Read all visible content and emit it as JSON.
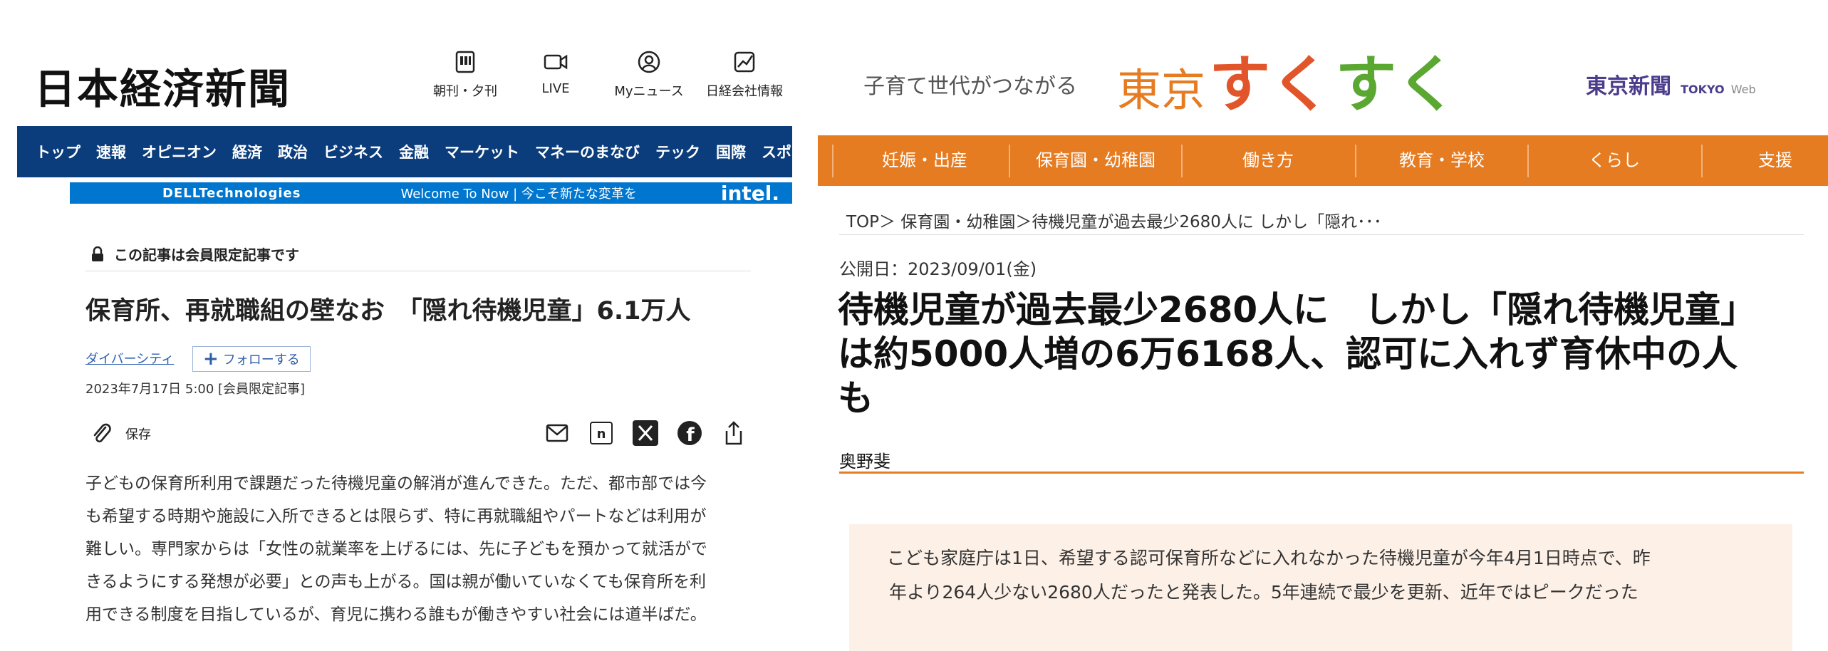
{
  "nikkei": {
    "logo": "日本経済新聞",
    "header_links": [
      "朝刊・夕刊",
      "LIVE",
      "Myニュース",
      "日経会社情報"
    ],
    "nav": [
      "トップ",
      "速報",
      "オピニオン",
      "経済",
      "政治",
      "ビジネス",
      "金融",
      "マーケット",
      "マネーのまなび",
      "テック",
      "国際",
      "スポーツ"
    ],
    "ad": {
      "brand": "DELLTechnologies",
      "text": "Welcome To Now | 今こそ新たな変革を",
      "partner": "intel."
    },
    "member_notice": "この記事は会員限定記事です",
    "title": "保育所、再就職組の壁なお　「隠れ待機児童」6.1万人",
    "topic_tag": "ダイバーシティ",
    "follow_label": "フォローする",
    "date": "2023年7月17日 5:00 [会員限定記事]",
    "save_label": "保存",
    "share_icons": [
      "mail-icon",
      "note-icon",
      "x-icon",
      "facebook-icon",
      "share-icon"
    ],
    "body_lines": [
      "子どもの保育所利用で課題だった待機児童の解消が進んできた。ただ、都市部では今",
      "も希望する時期や施設に入所できるとは限らず、特に再就職組やパートなどは利用が",
      "難しい。専門家からは「女性の就業率を上げるには、先に子どもを預かって就活がで",
      "きるようにする発想が必要」との声も上がる。国は親が働いていなくても保育所を利",
      "用できる制度を目指しているが、育児に携わる誰もが働きやすい社会には道半ばだ。"
    ]
  },
  "tokyo": {
    "tagline": "子育て世代がつながる",
    "logo_main": "東京",
    "logo_sub_1": "すく",
    "logo_sub_2": "すく",
    "newspaper": "東京新聞",
    "newspaper_en": "TOKYO",
    "newspaper_web": "Web",
    "nav": [
      "妊娠・出産",
      "保育園・幼稚園",
      "働き方",
      "教育・学校",
      "くらし",
      "支援"
    ],
    "breadcrumb": "TOP＞ 保育園・幼稚園＞待機児童が過去最少2680人に しかし「隠れ･･･",
    "published": "公開日：2023/09/01(金)",
    "title_lines": [
      "待機児童が過去最少2680人に　しかし「隠れ待機児童」",
      "は約5000人増の6万6168人、認可に入れず育休中の人",
      "も"
    ],
    "author": "奥野斐",
    "lead_lines": [
      "　こども家庭庁は1日、希望する認可保育所などに入れなかった待機児童が今年4月1日時点で、昨",
      "年より264人少ない2680人だったと発表した。5年連続で最少を更新、近年ではピークだった"
    ]
  }
}
